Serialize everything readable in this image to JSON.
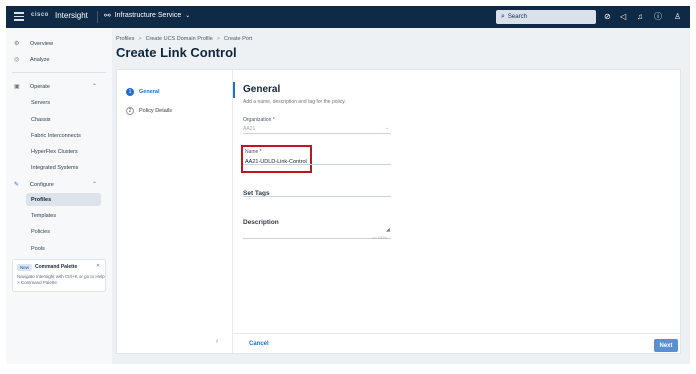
{
  "topbar": {
    "logo_text": "cisco",
    "app_name": "Intersight",
    "service_icon": "service-icon",
    "service_label": "Infrastructure Service",
    "service_chevron": "⌄",
    "search_placeholder": "Search",
    "icons": [
      "check-circle-icon",
      "megaphone-icon",
      "bell-icon",
      "help-icon",
      "user-icon"
    ]
  },
  "sidebar": {
    "overview": "Overview",
    "analyze": "Analyze",
    "operate": "Operate",
    "servers": "Servers",
    "chassis": "Chassis",
    "fabric_interconnects": "Fabric Interconnects",
    "hyperflex_clusters": "HyperFlex Clusters",
    "integrated_systems": "Integrated Systems",
    "configure": "Configure",
    "profiles": "Profiles",
    "templates": "Templates",
    "policies": "Policies",
    "pools": "Pools",
    "palette": {
      "badge": "New",
      "title": "Command Palette",
      "text": "Navigate Intersight with Ctrl+K or go to Help > Command Palette"
    }
  },
  "breadcrumbs": {
    "b1": "Profiles",
    "b2": "Create UCS Domain Profile",
    "b3": "Create Port",
    "sep": ">"
  },
  "page_title": "Create Link Control",
  "steps": {
    "step1_num": "1",
    "step1_label": "General",
    "step2_num": "2",
    "step2_label": "Policy Details"
  },
  "form": {
    "title": "General",
    "subtitle": "Add a name, description and tag for the policy.",
    "organization_label": "Organization *",
    "organization_value": "AA21",
    "name_label": "Name *",
    "name_value": "AA21-UDLD-Link-Control",
    "tags_label": "Set Tags",
    "description_label": "Description",
    "counter": "<= 1024"
  },
  "footer": {
    "cancel": "Cancel",
    "next": "Next"
  },
  "colors": {
    "topbar": "#0f2a47",
    "accent": "#1f6fcb",
    "highlight_box": "#c0151f"
  }
}
